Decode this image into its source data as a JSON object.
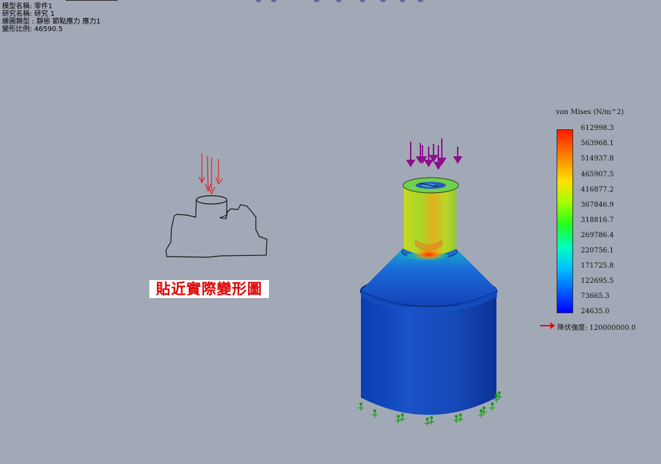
{
  "info": {
    "model_name": "模型名稱: 零件1",
    "study_name": "研究名稱: 研究 1",
    "plot_type": "繪圖類型 : 靜態 節點應力 應力1",
    "deform_scale": "變形比例: 46590.5"
  },
  "legend": {
    "title": "von Mises (N/m^2)",
    "values": [
      "612998.3",
      "563968.1",
      "514937.8",
      "465907.5",
      "416877.2",
      "367846.9",
      "318816.7",
      "269786.4",
      "220756.1",
      "171725.8",
      "122695.5",
      "73665.3",
      "24635.0"
    ],
    "yield": "降伏強度: 120000000.0"
  },
  "annotation": {
    "banner": "貼近實際變形圖"
  },
  "colors": {
    "background": "#a2a9b6",
    "banner_text": "#e00000",
    "load_arrow": "#8b0f8b",
    "fixture": "#1a9a1a",
    "sketch_arrow": "#e02020"
  },
  "icons": [
    "load-arrow-icon",
    "fixture-icon",
    "yield-arrow-icon"
  ]
}
